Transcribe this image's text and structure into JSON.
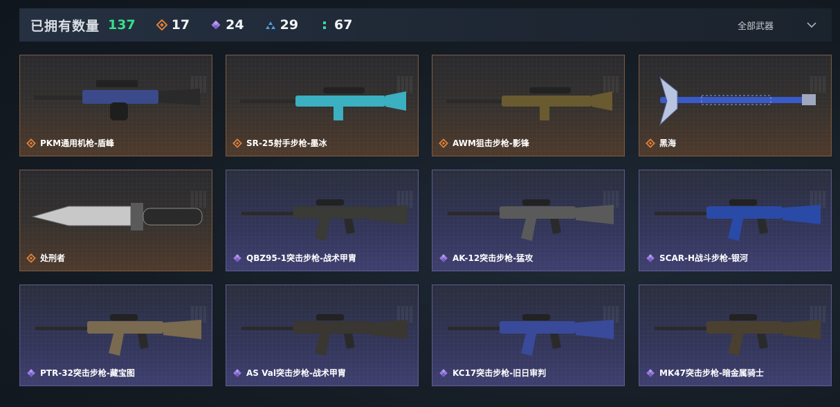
{
  "header": {
    "owned_label": "已拥有数量",
    "owned_count": "137",
    "stats": [
      {
        "icon": "orange-diamond-icon",
        "color": "#e0813a",
        "value": "17"
      },
      {
        "icon": "purple-diamond-icon",
        "color": "#9b7be0",
        "value": "24"
      },
      {
        "icon": "blue-triangle-icon",
        "color": "#4f9de0",
        "value": "29"
      },
      {
        "icon": "green-dots-icon",
        "color": "#3fd6a0",
        "value": "67"
      }
    ],
    "filter_label": "全部武器"
  },
  "weapons": [
    {
      "name": "PKM通用机枪-盾峰",
      "rarity": "gold",
      "kind": "machinegun",
      "tint": "#3a4a8a"
    },
    {
      "name": "SR-25射手步枪-墨冰",
      "rarity": "gold",
      "kind": "sniper",
      "tint": "#3ab0c0"
    },
    {
      "name": "AWM狙击步枪-影锋",
      "rarity": "gold",
      "kind": "sniper",
      "tint": "#6a5a30"
    },
    {
      "name": "黑海",
      "rarity": "gold",
      "kind": "axe",
      "tint": "#3a5ac8"
    },
    {
      "name": "处刑者",
      "rarity": "gold",
      "kind": "knife",
      "tint": "#8a8a8a"
    },
    {
      "name": "QBZ95-1突击步枪-战术甲胄",
      "rarity": "purple",
      "kind": "rifle",
      "tint": "#3a3a36"
    },
    {
      "name": "AK-12突击步枪-猛攻",
      "rarity": "purple",
      "kind": "rifle",
      "tint": "#5a5a5a"
    },
    {
      "name": "SCAR-H战斗步枪-银河",
      "rarity": "purple",
      "kind": "rifle",
      "tint": "#2a4aa8"
    },
    {
      "name": "PTR-32突击步枪-藏宝图",
      "rarity": "purple",
      "kind": "rifle",
      "tint": "#7a6a50"
    },
    {
      "name": "AS Val突击步枪-战术甲胄",
      "rarity": "purple",
      "kind": "rifle",
      "tint": "#3a3632"
    },
    {
      "name": "KC17突击步枪-旧日审判",
      "rarity": "purple",
      "kind": "rifle",
      "tint": "#3a4a9a"
    },
    {
      "name": "MK47突击步枪-暗金属骑士",
      "rarity": "purple",
      "kind": "rifle",
      "tint": "#4a4030"
    }
  ],
  "colors": {
    "owned_green": "#35e08a",
    "gold_border": "#7a5a3e",
    "purple_border": "#5c5a8c",
    "gold_rarity": "#e0813a",
    "purple_rarity": "#9b7be0"
  }
}
